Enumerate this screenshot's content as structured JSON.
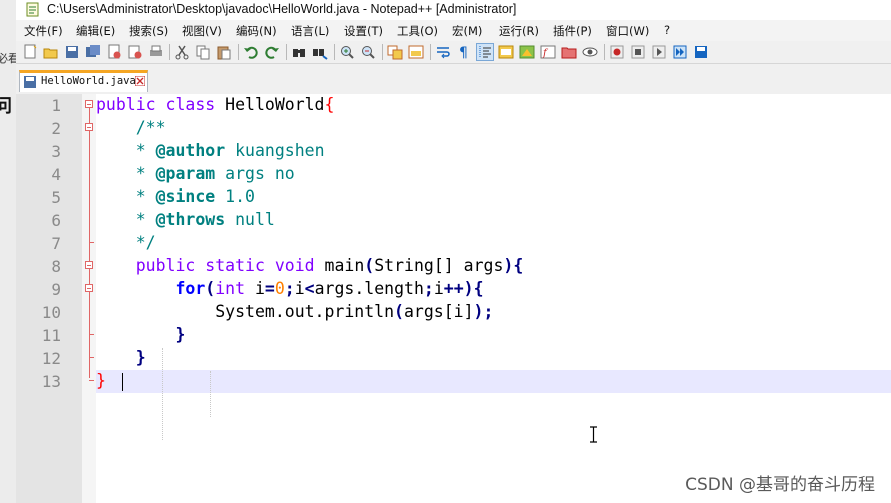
{
  "window": {
    "title": "C:\\Users\\Administrator\\Desktop\\javadoc\\HelloWorld.java - Notepad++ [Administrator]"
  },
  "background_window": {
    "glyph1": "必看",
    "glyph2": "问"
  },
  "menu": [
    "文件(F)",
    "编辑(E)",
    "搜索(S)",
    "视图(V)",
    "编码(N)",
    "语言(L)",
    "设置(T)",
    "工具(O)",
    "宏(M)",
    "运行(R)",
    "插件(P)",
    "窗口(W)",
    "?"
  ],
  "tab": {
    "label": "HelloWorld.java"
  },
  "editor": {
    "line_numbers": [
      "1",
      "2",
      "3",
      "4",
      "5",
      "6",
      "7",
      "8",
      "9",
      "10",
      "11",
      "12",
      "13"
    ],
    "tokens": {
      "public": "public",
      "class": "class",
      "classname": "HelloWorld",
      "lbrace": "{",
      "rbrace": "}",
      "doc_open": "/**",
      "doc_close": "*/",
      "star": "*",
      "tag_author": "@author",
      "val_author": "kuangshen",
      "tag_param": "@param",
      "val_param": "args no",
      "tag_since": "@since",
      "val_since": "1.0",
      "tag_throws": "@throws",
      "val_throws": "null",
      "static": "static",
      "void": "void",
      "main": "main",
      "lparen": "(",
      "rparen": ")",
      "string_arr": "String[]",
      "args": "args",
      "for": "for",
      "int": "int",
      "i": "i",
      "eq": "=",
      "zero": "0",
      "semi": ";",
      "lt": "<",
      "args_length": "args.length",
      "inc": "++",
      "println": "System.out.println",
      "args_i": "args[i]"
    }
  },
  "watermark": "CSDN @基哥的奋斗历程",
  "colors": {
    "keyword": "#8000ff",
    "comment": "#008080",
    "control": "#0000ff",
    "number": "#ff8000",
    "brace_match": "#ff0000",
    "current_line": "#e8e8ff",
    "tab_accent": "#f5a623"
  }
}
